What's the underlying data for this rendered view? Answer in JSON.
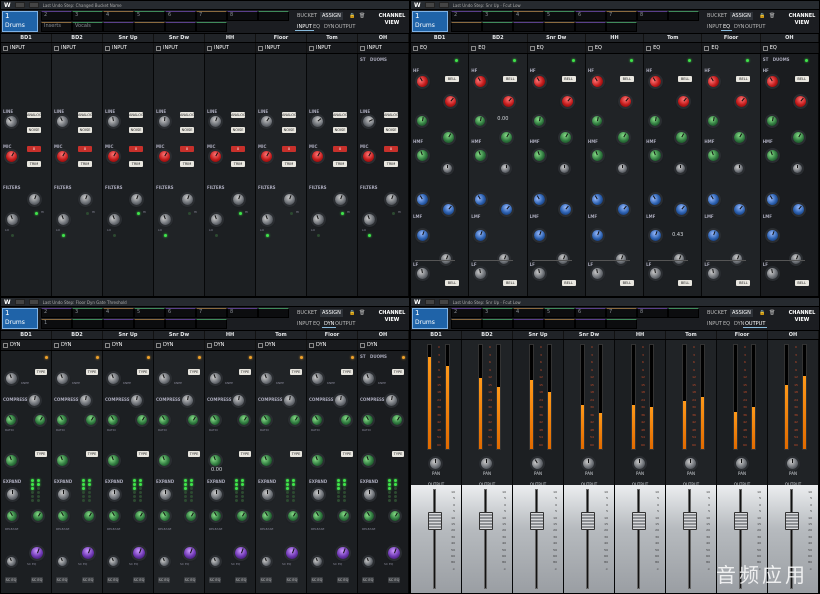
{
  "watermark": "音频应用",
  "quads": [
    {
      "undo": "Last Undo Step: Changed Bucket Name",
      "group": {
        "number": "1",
        "name": "Drums"
      },
      "slots": [
        "2",
        "3",
        "4",
        "5",
        "6",
        "7",
        "8",
        "",
        "Inserts",
        "Vocals",
        "",
        "",
        "",
        ""
      ],
      "bucket": "BUCKET",
      "assign": "ASSIGN",
      "modules": [
        "INPUT",
        "EQ",
        "DYN",
        "OUTPUT"
      ],
      "selected_module": "INPUT",
      "channel_view": "CHANNEL VIEW",
      "channels": [
        "BD1",
        "BD2",
        "Snr Up",
        "Snr Dw",
        "HH",
        "Floor",
        "Tom",
        "OH"
      ],
      "module_label": "INPUT",
      "modes": [
        "ST",
        "DUO",
        "MS"
      ],
      "labels": {
        "line": "LINE",
        "mic": "MIC",
        "filters": "FILTERS",
        "analog": "ANALOG",
        "noise": "NOISE",
        "trim": "TRIM",
        "lo": "LO",
        "hi": "HI"
      },
      "mic_value": "0"
    },
    {
      "undo": "Last Undo Step: Snr Up · Fcut Low",
      "group": {
        "number": "1",
        "name": "Drums"
      },
      "slots": [
        "2",
        "3",
        "4",
        "5",
        "6",
        "7",
        "8",
        "",
        "",
        "",
        "",
        "",
        "",
        ""
      ],
      "bucket": "BUCKET",
      "assign": "ASSIGN",
      "modules": [
        "INPUT",
        "EQ",
        "DYN",
        "OUTPUT"
      ],
      "selected_module": "EQ",
      "channel_view": "CHANNEL VIEW",
      "channels": [
        "BD1",
        "BD2",
        "Snr Dw",
        "HH",
        "Tom",
        "Floor",
        "OH"
      ],
      "module_label": "EQ",
      "modes": [
        "ST",
        "DUO",
        "MS"
      ],
      "labels": {
        "hf": "HF",
        "hmf": "HMF",
        "lmf": "LMF",
        "lf": "LF",
        "bell": "BELL",
        "q": "Q"
      },
      "readout_hmf": "0.00",
      "readout_lmf": "0.43"
    },
    {
      "undo": "Last Undo Step: Floor Dyn Gate Threshold",
      "group": {
        "number": "1",
        "name": "Drums"
      },
      "slots": [
        "2",
        "3",
        "4",
        "5",
        "6",
        "7",
        "8",
        "",
        "1",
        "",
        "",
        "",
        "",
        ""
      ],
      "bucket": "BUCKET",
      "assign": "ASSIGN",
      "modules": [
        "INPUT",
        "EQ",
        "DYN",
        "OUTPUT"
      ],
      "selected_module": "DYN",
      "channel_view": "CHANNEL VIEW",
      "channels": [
        "BD1",
        "BD2",
        "Snr Up",
        "Snr Dw",
        "HH",
        "Tom",
        "Floor",
        "OH"
      ],
      "module_label": "DYN",
      "modes": [
        "ST",
        "DUO",
        "MS"
      ],
      "labels": {
        "compress": "COMPRESS",
        "expand": "EXPAND",
        "type": "TYPE",
        "ratio": "RATIO",
        "release": "RELEASE",
        "thresh": "THRESH",
        "knee": "KNEE",
        "sc": "SC EQ"
      },
      "readout_expand": "0.00"
    },
    {
      "undo": "Last Undo Step: Snr Up · Fcut Low",
      "group": {
        "number": "1",
        "name": "Drums"
      },
      "slots": [
        "2",
        "3",
        "4",
        "5",
        "6",
        "7",
        "8",
        "",
        "",
        "",
        "",
        "",
        "",
        ""
      ],
      "bucket": "BUCKET",
      "assign": "ASSIGN",
      "modules": [
        "INPUT",
        "EQ",
        "DYN",
        "OUTPUT"
      ],
      "selected_module": "OUTPUT",
      "channel_view": "CHANNEL VIEW",
      "channels": [
        "BD1",
        "BD2",
        "Snr Up",
        "Snr Dw",
        "HH",
        "Tom",
        "Floor",
        "OH"
      ],
      "labels": {
        "pan": "PAN",
        "output": "OUTPUT"
      },
      "meter_levels": [
        0.88,
        0.68,
        0.66,
        0.42,
        0.42,
        0.46,
        0.36,
        0.62
      ],
      "meter_levels_r": [
        0.8,
        0.6,
        0.55,
        0.35,
        0.4,
        0.5,
        0.4,
        0.7
      ],
      "fader_levels": [
        0.72,
        0.72,
        0.72,
        0.72,
        0.72,
        0.72,
        0.72,
        0.72
      ],
      "meter_scale": [
        "0",
        "3",
        "6",
        "9",
        "12",
        "15",
        "18",
        "24",
        "30",
        "36",
        "42",
        "48",
        "54",
        "60"
      ],
      "fader_scale": [
        "10",
        "5",
        "0",
        "5",
        "10",
        "15",
        "20",
        "30",
        "40",
        "50",
        "60",
        "80",
        "∞"
      ]
    }
  ]
}
